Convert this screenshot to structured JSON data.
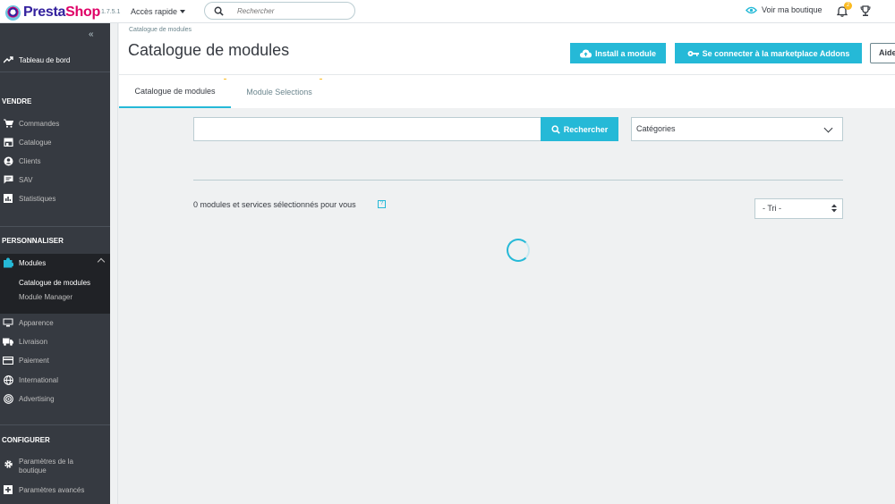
{
  "topbar": {
    "logo_text_1": "Presta",
    "logo_text_2": "Shop",
    "version": "1.7.5.1",
    "quick_access": "Accès rapide",
    "search_placeholder": "Rechercher",
    "view_shop": "Voir ma boutique",
    "notification_count": "2"
  },
  "sidebar": {
    "collapse_icon": "double-chevron-left",
    "dashboard": "Tableau de bord",
    "sections": {
      "sell": "VENDRE",
      "customize": "PERSONNALISER",
      "configure": "CONFIGURER"
    },
    "sell_items": [
      "Commandes",
      "Catalogue",
      "Clients",
      "SAV",
      "Statistiques"
    ],
    "modules": {
      "label": "Modules",
      "sub_items": [
        "Catalogue de modules",
        "Module Manager"
      ]
    },
    "customize_items": [
      "Apparence",
      "Livraison",
      "Paiement",
      "International",
      "Advertising"
    ],
    "configure_items": [
      "Paramètres de la boutique",
      "Paramètres avancés"
    ]
  },
  "header": {
    "breadcrumb": "Catalogue de modules",
    "title": "Catalogue de modules",
    "install_button": "Install a module",
    "connect_button": "Se connecter à la marketplace Addons",
    "help_button": "Aide"
  },
  "tabs": [
    "Catalogue de modules",
    "Module Selections"
  ],
  "content": {
    "search_button": "Rechercher",
    "search_value": "",
    "categories_select": "Catégories",
    "results_text": "0 modules et services sélectionnés pour vous",
    "help_marker": "?",
    "sort_select": "- Tri -"
  },
  "colors": {
    "accent": "#25b9d7",
    "sidebar_bg": "#363a41",
    "sidebar_active_bg": "#202226",
    "brand_pink": "#df0067",
    "badge": "#fbbb22"
  }
}
